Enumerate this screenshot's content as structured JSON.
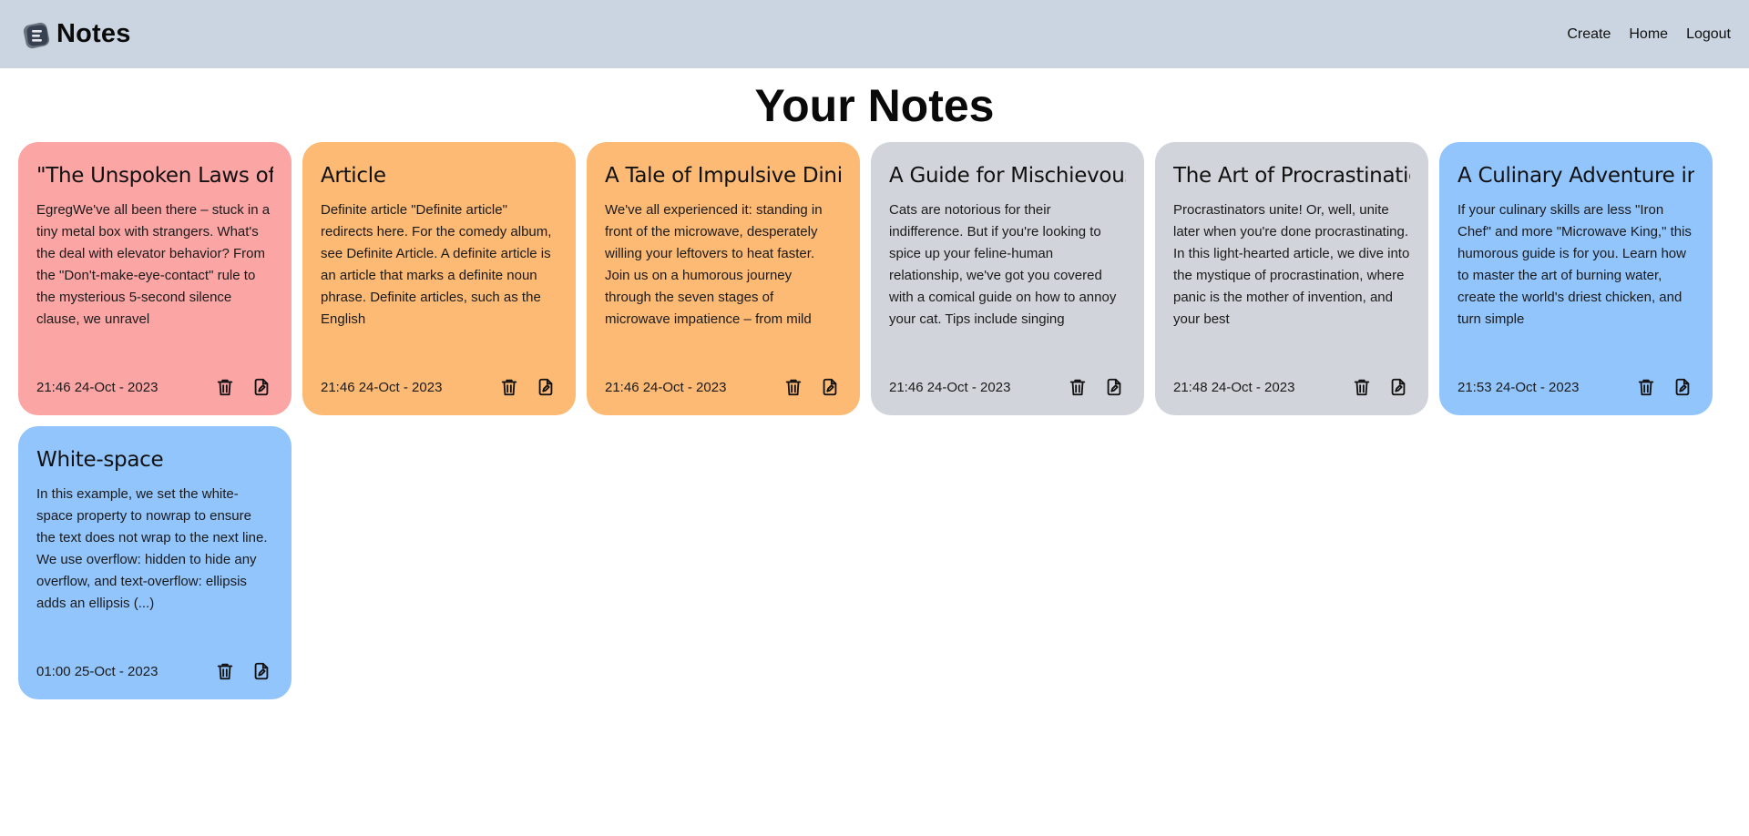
{
  "brand": {
    "name": "Notes",
    "logo_icon": "notes-logo-icon"
  },
  "nav": {
    "links": [
      "Create",
      "Home",
      "Logout"
    ]
  },
  "page_title": "Your Notes",
  "colors": {
    "navbar": "#cbd5e1",
    "red": "#fca5a5",
    "orange": "#fdba74",
    "gray": "#d1d5db",
    "blue": "#93c5fd"
  },
  "notes": [
    {
      "title": "\"The Unspoken Laws of",
      "body": "EgregWe've all been there – stuck in a tiny metal box with strangers. What's the deal with elevator behavior? From the \"Don't-make-eye-contact\" rule to the mysterious 5-second silence clause, we unravel",
      "date": "21:46 24-Oct - 2023",
      "color": "#fca5a5"
    },
    {
      "title": "Article",
      "body": "Definite article \"Definite article\" redirects here. For the comedy album, see Definite Article. A definite article is an article that marks a definite noun phrase. Definite articles, such as the English",
      "date": "21:46 24-Oct - 2023",
      "color": "#fdba74"
    },
    {
      "title": "A Tale of Impulsive Dinir",
      "body": "We've all experienced it: standing in front of the microwave, desperately willing your leftovers to heat faster. Join us on a humorous journey through the seven stages of microwave impatience – from mild",
      "date": "21:46 24-Oct - 2023",
      "color": "#fdba74"
    },
    {
      "title": "A Guide for Mischievous",
      "body": "Cats are notorious for their indifference. But if you're looking to spice up your feline-human relationship, we've got you covered with a comical guide on how to annoy your cat. Tips include singing",
      "date": "21:46 24-Oct - 2023",
      "color": "#d1d5db"
    },
    {
      "title": "The Art of Procrastinatic",
      "body": "Procrastinators unite! Or, well, unite later when you're done procrastinating. In this light-hearted article, we dive into the mystique of procrastination, where panic is the mother of invention, and your best",
      "date": "21:48 24-Oct - 2023",
      "color": "#d1d5db"
    },
    {
      "title": "A Culinary Adventure in",
      "body": "If your culinary skills are less \"Iron Chef\" and more \"Microwave King,\" this humorous guide is for you. Learn how to master the art of burning water, create the world's driest chicken, and turn simple",
      "date": "21:53 24-Oct - 2023",
      "color": "#93c5fd"
    },
    {
      "title": "White-space",
      "body": "In this example, we set the white-space property to nowrap to ensure the text does not wrap to the next line. We use overflow: hidden to hide any overflow, and text-overflow: ellipsis adds an ellipsis (...)",
      "date": "01:00 25-Oct - 2023",
      "color": "#93c5fd"
    }
  ],
  "card_icons": {
    "delete": "trash-icon",
    "edit": "edit-file-icon"
  }
}
